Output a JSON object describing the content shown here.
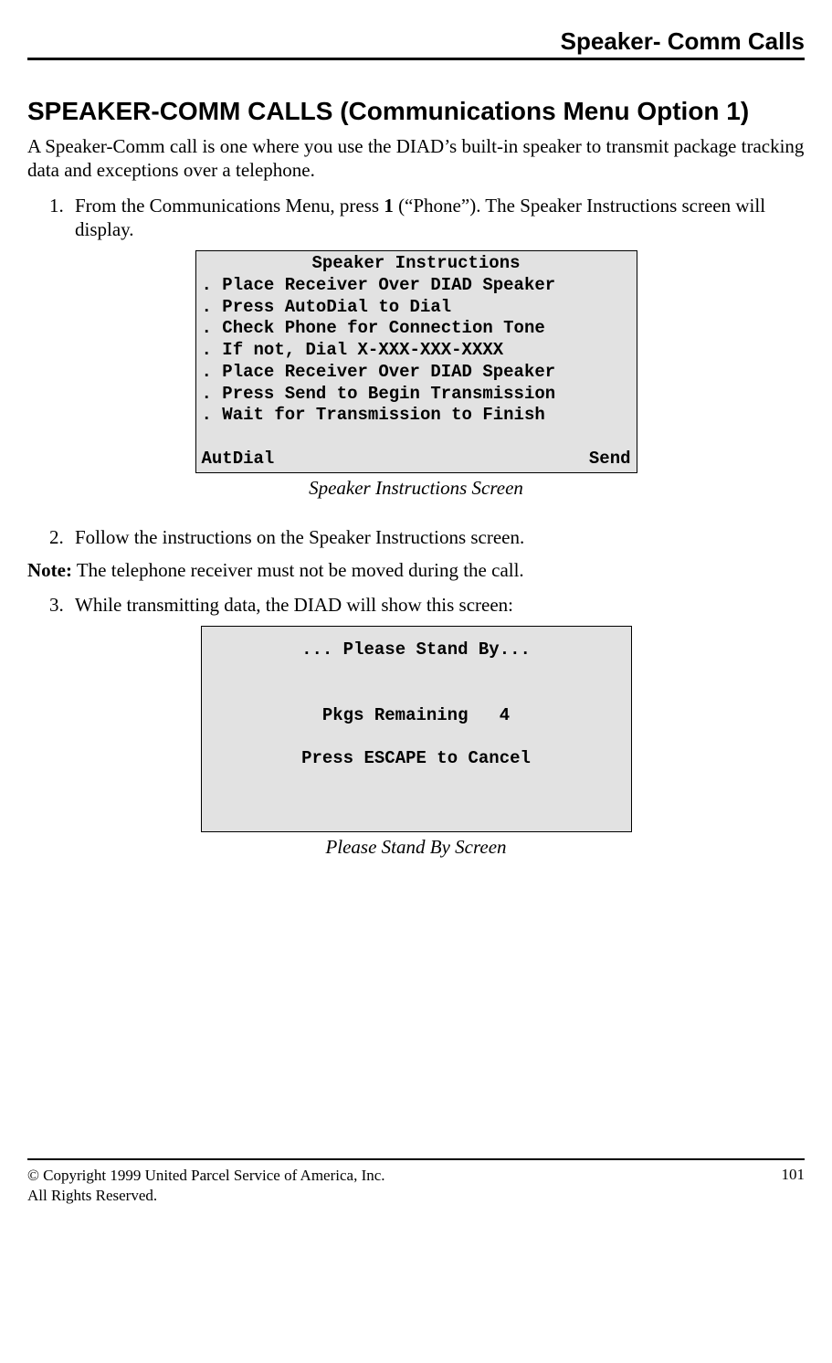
{
  "header": {
    "title": "Speaker- Comm Calls"
  },
  "main": {
    "heading": "SPEAKER-COMM CALLS (Communications Menu Option 1)",
    "intro": "A Speaker-Comm call is one where you use the DIAD’s built-in speaker to transmit package tracking data and exceptions over a telephone.",
    "step1_pre": "From the Communications Menu, press ",
    "step1_bold": "1",
    "step1_post": " (“Phone”). The Speaker Instructions screen will display.",
    "screen1": {
      "title": "Speaker Instructions",
      "lines": [
        ". Place Receiver Over DIAD Speaker",
        ". Press AutoDial to Dial",
        ". Check Phone for Connection Tone",
        ". If not, Dial X-XXX-XXX-XXXX",
        ". Place Receiver Over DIAD Speaker",
        ". Press Send to Begin Transmission",
        ". Wait for Transmission to Finish"
      ],
      "left_btn": "AutDial",
      "right_btn": "Send"
    },
    "caption1": "Speaker Instructions Screen",
    "step2": "Follow the instructions on the Speaker Instructions screen.",
    "note_label": "Note:",
    "note_text": " The telephone receiver must not be moved during the call.",
    "step3": "While transmitting data, the DIAD will show this screen:",
    "screen2": {
      "line1": "... Please Stand By...",
      "pkgs_label": "Pkgs Remaining",
      "pkgs_value": "4",
      "cancel": "Press ESCAPE to Cancel"
    },
    "caption2": "Please Stand By Screen"
  },
  "footer": {
    "copyright": "© Copyright 1999 United Parcel Service of America, Inc.",
    "rights": "All Rights Reserved.",
    "page": "101"
  }
}
